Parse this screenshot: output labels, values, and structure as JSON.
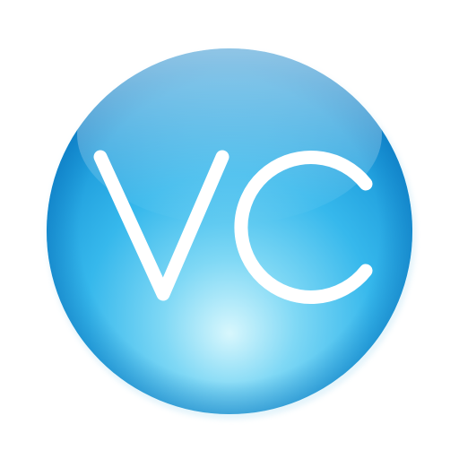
{
  "logo": {
    "text": "VC",
    "colors": {
      "sphere_light": "#bff0fb",
      "sphere_mid": "#3ec0ee",
      "sphere_dark": "#0f8fd6",
      "rim": "#1a8ed2",
      "letters": "#ffffff",
      "background": "#ffffff"
    }
  }
}
